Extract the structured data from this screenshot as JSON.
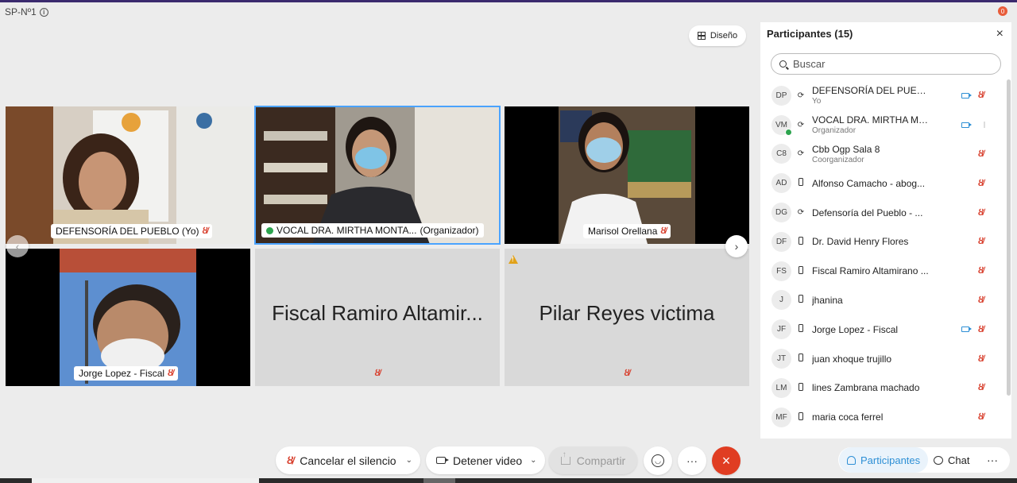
{
  "meeting": {
    "title": "SP-Nº1",
    "notifications": "0"
  },
  "layout_button": {
    "label": "Diseño"
  },
  "tiles": [
    {
      "name": "DEFENSORÍA DEL PUEBLO (Yo)"
    },
    {
      "name": "VOCAL DRA. MIRTHA MONTA...",
      "role": "(Organizador)"
    },
    {
      "name": "Marisol Orellana"
    },
    {
      "name": "Jorge Lopez - Fiscal"
    },
    {
      "name": "Fiscal Ramiro Altamir..."
    },
    {
      "name": "Pilar Reyes victima"
    }
  ],
  "panel": {
    "title": "Participantes (15)",
    "search_placeholder": "Buscar",
    "participants": [
      {
        "initials": "DP",
        "name": "DEFENSORÍA DEL PUEBLO",
        "role": "Yo",
        "device": "sync",
        "video": true
      },
      {
        "initials": "VM",
        "name": "VOCAL DRA. MIRTHA MO...",
        "role": "Organizador",
        "device": "sync",
        "video": true
      },
      {
        "initials": "C8",
        "name": "Cbb Ogp Sala 8",
        "role": "Coorganizador",
        "device": "sync",
        "video": false
      },
      {
        "initials": "AD",
        "name": "Alfonso Camacho - abog...",
        "role": "",
        "device": "phone",
        "video": false
      },
      {
        "initials": "DG",
        "name": "Defensoría del Pueblo - ...",
        "role": "",
        "device": "sync",
        "video": false
      },
      {
        "initials": "DF",
        "name": "Dr. David Henry Flores",
        "role": "",
        "device": "phone",
        "video": false
      },
      {
        "initials": "FS",
        "name": "Fiscal Ramiro Altamirano ...",
        "role": "",
        "device": "phone",
        "video": false
      },
      {
        "initials": "J",
        "name": "jhanina",
        "role": "",
        "device": "phone",
        "video": false
      },
      {
        "initials": "JF",
        "name": "Jorge Lopez - Fiscal",
        "role": "",
        "device": "phone",
        "video": true
      },
      {
        "initials": "JT",
        "name": "juan xhoque trujillo",
        "role": "",
        "device": "phone",
        "video": false
      },
      {
        "initials": "LM",
        "name": "lines Zambrana machado",
        "role": "",
        "device": "phone",
        "video": false
      },
      {
        "initials": "MF",
        "name": "maria coca ferrel",
        "role": "",
        "device": "phone",
        "video": false
      }
    ]
  },
  "controls": {
    "unmute": "Cancelar el silencio",
    "stop_video": "Detener video",
    "share": "Compartir"
  },
  "tabs": {
    "participants": "Participantes",
    "chat": "Chat"
  }
}
